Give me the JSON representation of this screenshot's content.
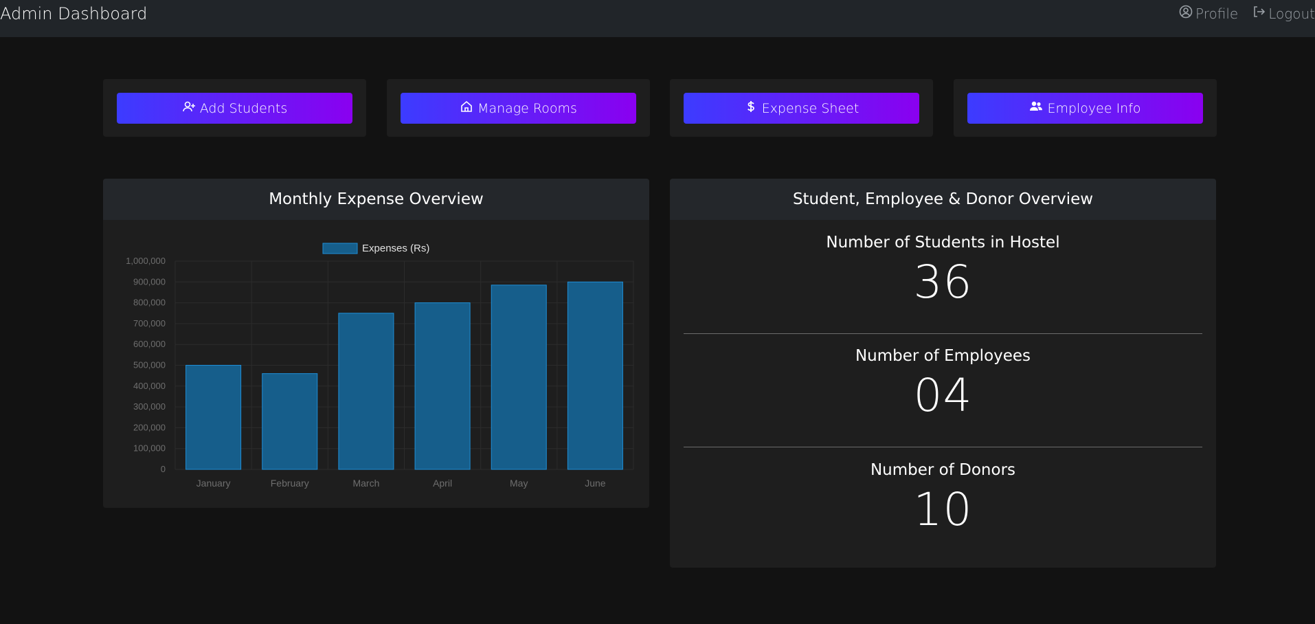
{
  "navbar": {
    "title": "Admin Dashboard",
    "links": [
      {
        "label": "Profile",
        "icon": "user-circle-icon"
      },
      {
        "label": "Logout",
        "icon": "logout-icon"
      }
    ]
  },
  "actions": [
    {
      "label": "Add Students",
      "icon": "user-plus-icon"
    },
    {
      "label": "Manage Rooms",
      "icon": "home-icon"
    },
    {
      "label": "Expense Sheet",
      "icon": "dollar-icon"
    },
    {
      "label": "Employee Info",
      "icon": "users-icon"
    }
  ],
  "expense_panel": {
    "title": "Monthly Expense Overview"
  },
  "overview_panel": {
    "title": "Student, Employee & Donor Overview",
    "stats": [
      {
        "label": "Number of Students in Hostel",
        "value": "36"
      },
      {
        "label": "Number of Employees",
        "value": "04"
      },
      {
        "label": "Number of Donors",
        "value": "10"
      }
    ]
  },
  "colors": {
    "button_gradient_start": "#3c3cff",
    "button_gradient_end": "#8a00f0",
    "bar_fill": "#165e8b",
    "bar_border": "#1f8ed6"
  },
  "chart_data": {
    "type": "bar",
    "categories": [
      "January",
      "February",
      "March",
      "April",
      "May",
      "June"
    ],
    "series": [
      {
        "name": "Expenses (Rs)",
        "values": [
          500000,
          460000,
          750000,
          800000,
          885000,
          900000
        ]
      }
    ],
    "ylim": [
      0,
      1000000
    ],
    "yticks": [
      "0",
      "100,000",
      "200,000",
      "300,000",
      "400,000",
      "500,000",
      "600,000",
      "700,000",
      "800,000",
      "900,000",
      "1,000,000"
    ],
    "legend": "top",
    "grid": true
  }
}
